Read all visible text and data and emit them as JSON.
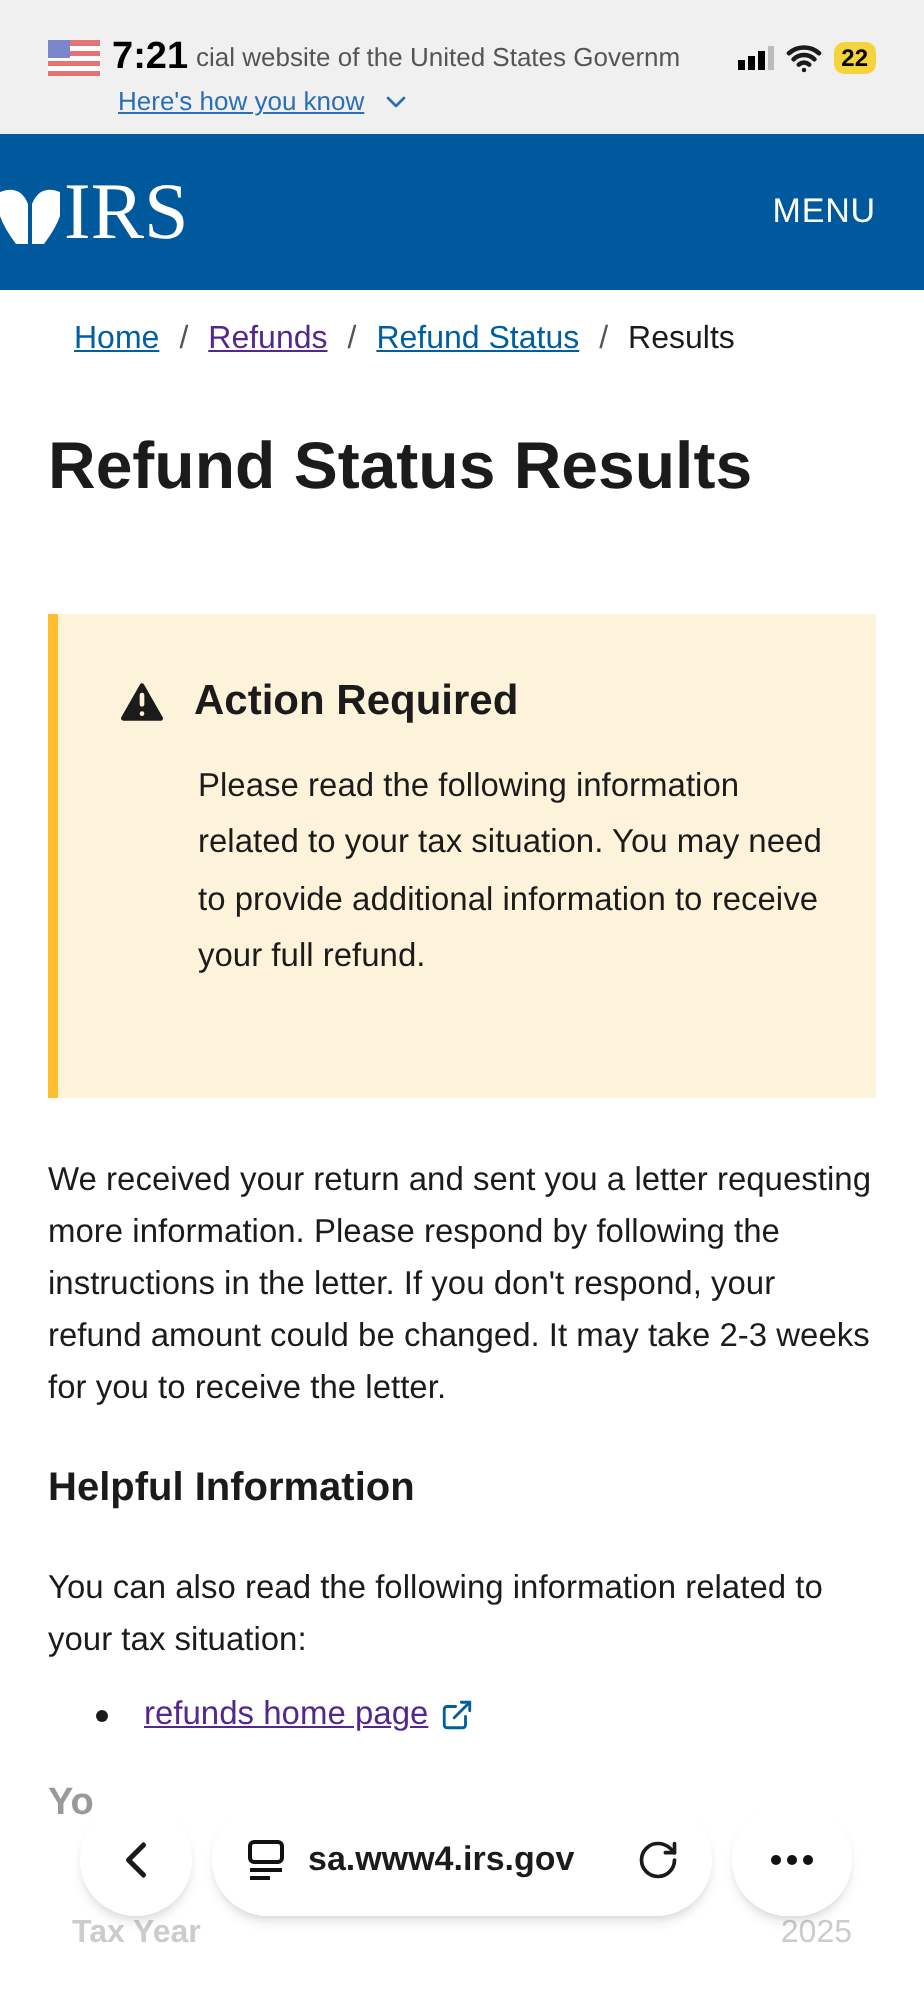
{
  "status_bar": {
    "time": "7:21",
    "battery": "22"
  },
  "gov_banner": {
    "text": "cial website of the United States Governm",
    "link": "Here's how you know",
    "expanded": false
  },
  "header": {
    "logo": "IRS",
    "menu": "MENU"
  },
  "breadcrumb": [
    {
      "label": "Home",
      "visited": false,
      "current": false
    },
    {
      "separator": "/",
      "label": "Refunds",
      "visited": true,
      "current": false
    },
    {
      "separator": "/",
      "label": "Refund Status",
      "visited": false,
      "current": false
    },
    {
      "separator": "/",
      "label": "Results",
      "current": true
    }
  ],
  "title": "Refund Status Results",
  "alert": {
    "title": "Action Required",
    "text": "Please read the following information related to your tax situation. You may need to provide additional information to receive your full refund."
  },
  "message": "We received your return and sent you a letter requesting more information. Please respond by following the instructions in the letter. If you don't respond, your refund amount could be changed. It may take 2-3 weeks for you to receive the letter.",
  "helpful": {
    "heading": "Helpful Information",
    "text": "You can also read the following information related to your tax situation:",
    "links": [
      "refunds home page"
    ]
  },
  "partial_heading": "Yo",
  "tax_row": {
    "label": "Tax Year",
    "value": "2025"
  },
  "browser_bar": {
    "url": "sa.www4.irs.gov"
  }
}
